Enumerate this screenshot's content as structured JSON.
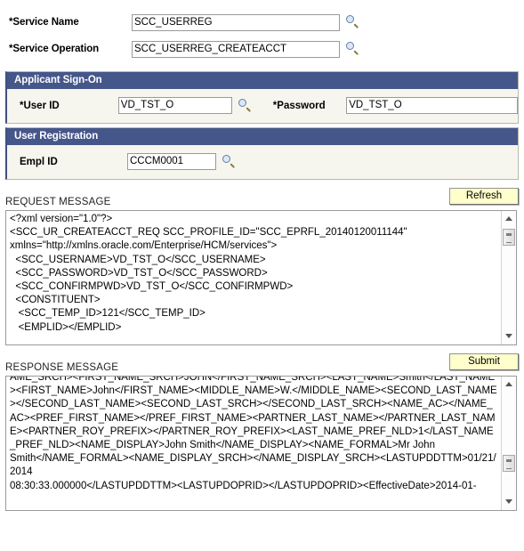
{
  "top_form": {
    "service_name": {
      "label": "*Service Name",
      "value": "SCC_USERREG"
    },
    "service_operation": {
      "label": "*Service Operation",
      "value": "SCC_USERREG_CREATEACCT"
    }
  },
  "applicant_signon": {
    "header": "Applicant Sign-On",
    "user_id": {
      "label": "*User ID",
      "value": "VD_TST_O"
    },
    "password": {
      "label": "*Password",
      "value": "VD_TST_O"
    }
  },
  "user_registration": {
    "header": "User Registration",
    "empl_id": {
      "label": "Empl ID",
      "value": "CCCM0001"
    }
  },
  "request_message": {
    "title": "REQUEST MESSAGE",
    "button": "Refresh",
    "content": "<?xml version=\"1.0\"?>\n<SCC_UR_CREATEACCT_REQ SCC_PROFILE_ID=\"SCC_EPRFL_20140120011144\"\nxmlns=\"http://xmlns.oracle.com/Enterprise/HCM/services\">\n  <SCC_USERNAME>VD_TST_O</SCC_USERNAME>\n  <SCC_PASSWORD>VD_TST_O</SCC_PASSWORD>\n  <SCC_CONFIRMPWD>VD_TST_O</SCC_CONFIRMPWD>\n  <CONSTITUENT>\n   <SCC_TEMP_ID>121</SCC_TEMP_ID>\n   <EMPLID></EMPLID>"
  },
  "response_message": {
    "title": "RESPONSE MESSAGE",
    "button": "Submit",
    "content": "AME_SRCH><FIRST_NAME_SRCH>JOHN</FIRST_NAME_SRCH><LAST_NAME>Smith</LAST_NAME><FIRST_NAME>John</FIRST_NAME><MIDDLE_NAME>W.</MIDDLE_NAME><SECOND_LAST_NAME></SECOND_LAST_NAME><SECOND_LAST_SRCH></SECOND_LAST_SRCH><NAME_AC></NAME_AC><PREF_FIRST_NAME></PREF_FIRST_NAME><PARTNER_LAST_NAME></PARTNER_LAST_NAME><PARTNER_ROY_PREFIX></PARTNER_ROY_PREFIX><LAST_NAME_PREF_NLD>1</LAST_NAME_PREF_NLD><NAME_DISPLAY>John Smith</NAME_DISPLAY><NAME_FORMAL>Mr John\nSmith</NAME_FORMAL><NAME_DISPLAY_SRCH></NAME_DISPLAY_SRCH><LASTUPDDTTM>01/21/2014\n08:30:33.000000</LASTUPDDTTM><LASTUPDOPRID></LASTUPDOPRID><EffectiveDate>2014-01-"
  },
  "icons": {
    "lookup": "magnifier-icon"
  },
  "colors": {
    "header_bar": "#45568a",
    "panel_bg": "#f6f6ee",
    "button_bg": "#ffffcc",
    "panel_left_accent": "#3f4f7d"
  }
}
